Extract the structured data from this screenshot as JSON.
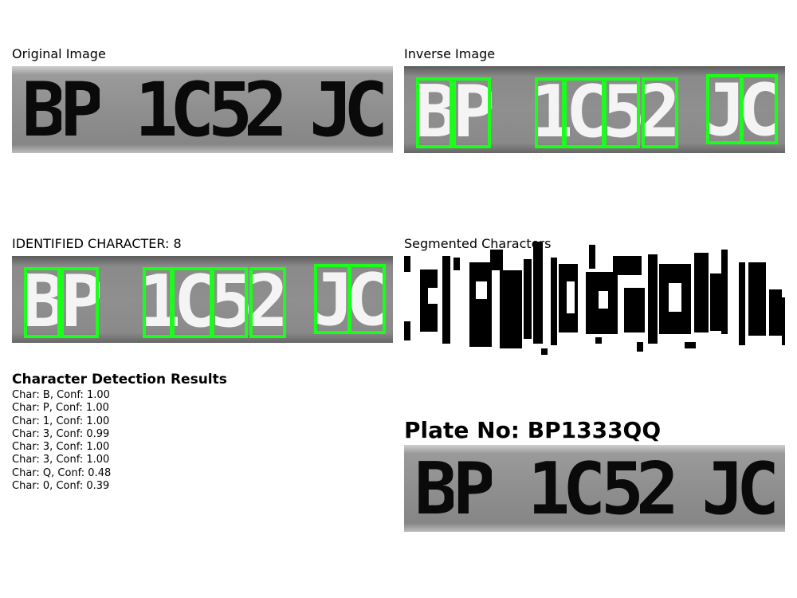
{
  "panels": {
    "original": {
      "title": "Original Image"
    },
    "inverse": {
      "title": "Inverse Image"
    },
    "identified": {
      "title": "IDENTIFIED CHARACTER: 8"
    },
    "segmented": {
      "title": "Segmented Characters"
    }
  },
  "plate_image": {
    "characters": [
      "B",
      "P",
      "1",
      "C",
      "5",
      "2",
      "J",
      "C"
    ]
  },
  "results": {
    "title": "Character Detection Results",
    "items": [
      "Char: B, Conf: 1.00",
      "Char: P, Conf: 1.00",
      "Char: 1, Conf: 1.00",
      "Char: 3, Conf: 0.99",
      "Char: 3, Conf: 1.00",
      "Char: 3, Conf: 1.00",
      "Char: Q, Conf: 0.48",
      "Char: 0, Conf: 0.39"
    ]
  },
  "plate_number": "Plate No: BP1333QQ",
  "colors": {
    "box": "#19ff19",
    "background": "#ffffff"
  }
}
